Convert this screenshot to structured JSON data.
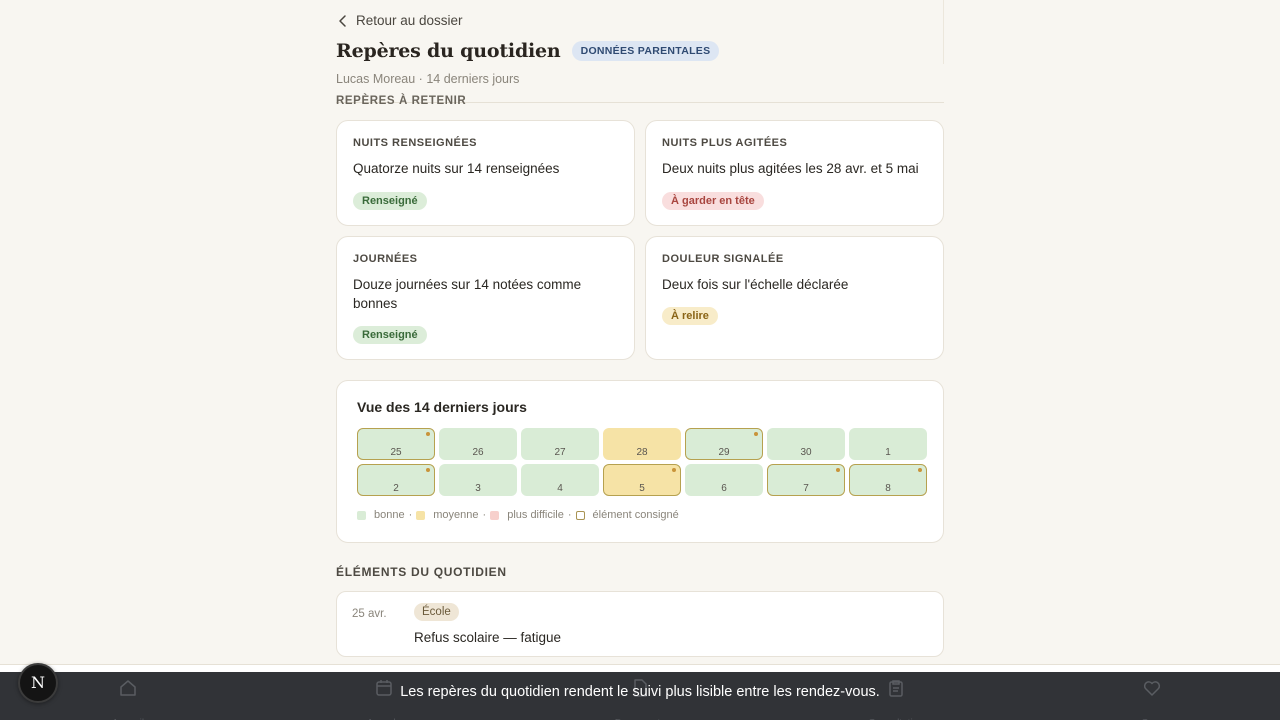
{
  "header": {
    "back_label": "Retour au dossier",
    "title": "Repères du quotidien",
    "badge": "DONNÉES PARENTALES",
    "subtitle": "Lucas Moreau · 14 derniers jours",
    "cut_section": "REPÈRES À RETENIR"
  },
  "cards": [
    {
      "kicker": "NUITS RENSEIGNÉES",
      "body": "Quatorze nuits sur 14 renseignées",
      "pill": "Renseigné",
      "tone": "green"
    },
    {
      "kicker": "NUITS PLUS AGITÉES",
      "body": "Deux nuits plus agitées les 28 avr. et 5 mai",
      "pill": "À garder en tête",
      "tone": "red"
    },
    {
      "kicker": "JOURNÉES",
      "body": "Douze journées sur 14 notées comme bonnes",
      "pill": "Renseigné",
      "tone": "green"
    },
    {
      "kicker": "DOULEUR SIGNALÉE",
      "body": "Deux fois sur l'échelle déclarée",
      "pill": "À relire",
      "tone": "yellow"
    }
  ],
  "calendar": {
    "title": "Vue des 14 derniers jours",
    "days": [
      {
        "label": "25",
        "status": "good",
        "marked": true
      },
      {
        "label": "26",
        "status": "good",
        "marked": false
      },
      {
        "label": "27",
        "status": "good",
        "marked": false
      },
      {
        "label": "28",
        "status": "mid",
        "marked": false
      },
      {
        "label": "29",
        "status": "good",
        "marked": true
      },
      {
        "label": "30",
        "status": "good",
        "marked": false
      },
      {
        "label": "1",
        "status": "good",
        "marked": false
      },
      {
        "label": "2",
        "status": "good",
        "marked": true
      },
      {
        "label": "3",
        "status": "good",
        "marked": false
      },
      {
        "label": "4",
        "status": "good",
        "marked": false
      },
      {
        "label": "5",
        "status": "mid",
        "marked": true
      },
      {
        "label": "6",
        "status": "good",
        "marked": false
      },
      {
        "label": "7",
        "status": "good",
        "marked": true
      },
      {
        "label": "8",
        "status": "good",
        "marked": true
      }
    ],
    "legend": {
      "good": "bonne",
      "mid": "moyenne",
      "bad": "plus difficile",
      "mark": "élément consigné",
      "sep": "·"
    }
  },
  "section_label": "ÉLÉMENTS DU QUOTIDIEN",
  "entry": {
    "date": "25 avr.",
    "tag": "École",
    "text": "Refus scolaire — fatigue"
  },
  "nav": {
    "home": "Accueil",
    "agenda": "Agenda",
    "documents": "Documents",
    "consultation": "Consultation",
    "care": "Care"
  },
  "toast": "Les repères du quotidien rendent le suivi plus lisible entre les rendez-vous.",
  "avatar_letter": "N",
  "colors": {
    "good": "#d9ecd6",
    "mid": "#f6e3a6",
    "bad": "#f7d0cc",
    "marker": "#c9943a",
    "toast": "#26282c"
  }
}
